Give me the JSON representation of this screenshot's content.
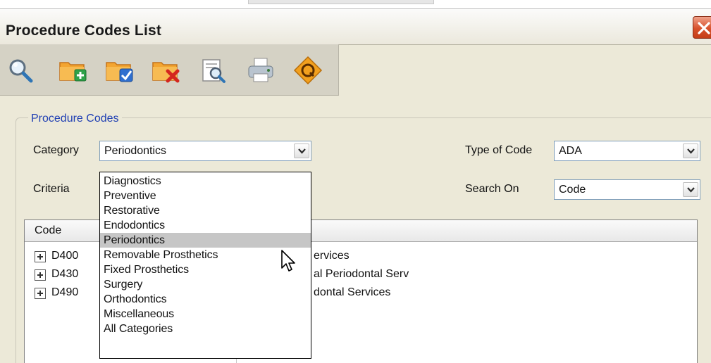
{
  "window": {
    "title": "Procedure Codes List"
  },
  "toolbar": {
    "buttons": [
      {
        "icon": "magnifier-icon"
      },
      {
        "icon": "add-folder-icon"
      },
      {
        "icon": "edit-folder-icon"
      },
      {
        "icon": "delete-folder-icon"
      },
      {
        "icon": "preview-icon"
      },
      {
        "icon": "printer-icon"
      },
      {
        "icon": "quick-icon"
      }
    ]
  },
  "procedure_codes": {
    "legend": "Procedure Codes",
    "category_label": "Category",
    "category_value": "Periodontics",
    "criteria_label": "Criteria",
    "type_of_code_label": "Type of Code",
    "type_of_code_value": "ADA",
    "search_on_label": "Search On",
    "search_on_value": "Code"
  },
  "grid": {
    "header_code": "Code",
    "rows": [
      {
        "code": "D400",
        "desc": "ervices"
      },
      {
        "code": "D430",
        "desc": "al Periodontal Serv"
      },
      {
        "code": "D490",
        "desc": "dontal Services"
      }
    ]
  },
  "category_dropdown": {
    "options": [
      "Diagnostics",
      "Preventive",
      "Restorative",
      "Endodontics",
      "Periodontics",
      "Removable Prosthetics",
      "Fixed Prosthetics",
      "Surgery",
      "Orthodontics",
      "Miscellaneous",
      "All Categories"
    ],
    "selected": "Periodontics"
  },
  "colors": {
    "legend_blue": "#1f3fb3",
    "close_red": "#d7512b",
    "window_bg": "#ece9d8",
    "selection_gray": "#c6c6c6"
  }
}
